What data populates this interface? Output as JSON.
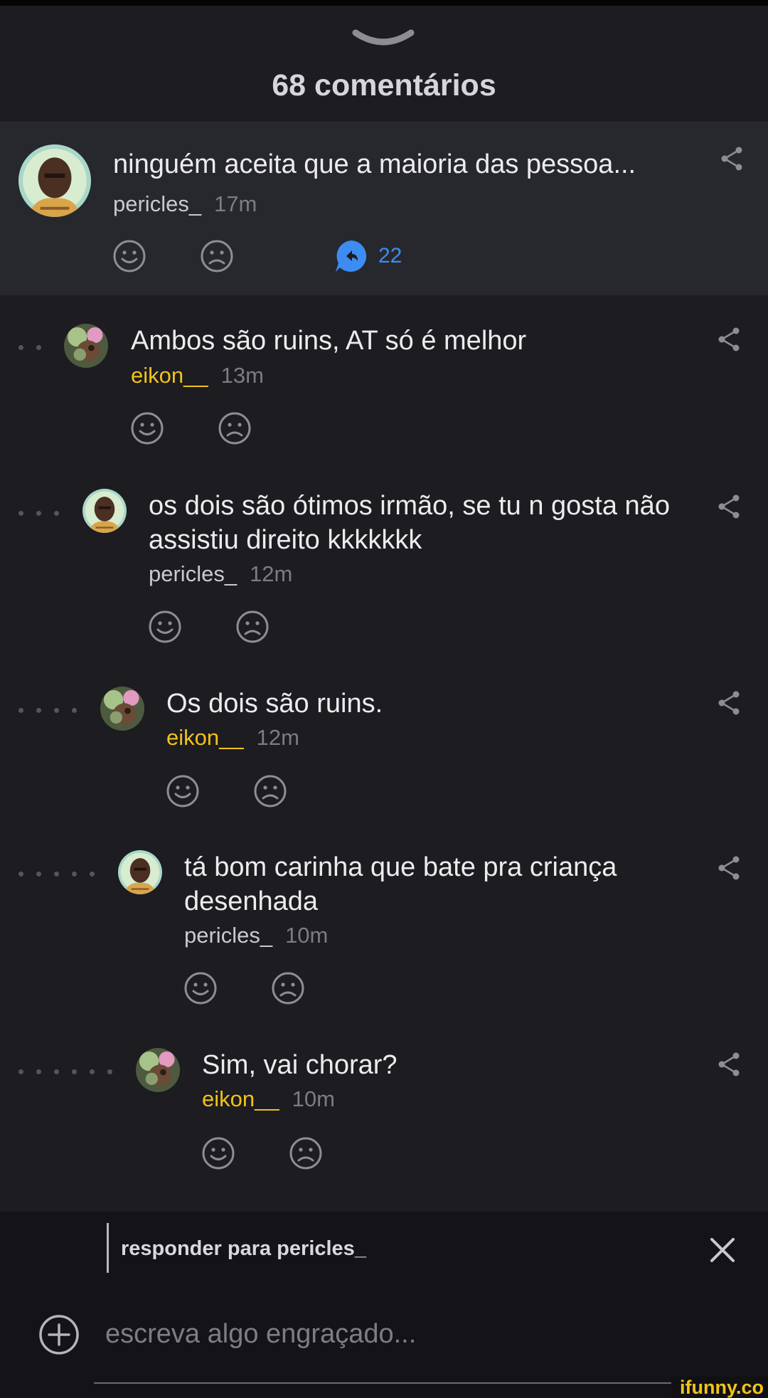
{
  "header": {
    "title": "68 comentários"
  },
  "comments": [
    {
      "text": "ninguém aceita que a maioria das pessoa...",
      "user": "pericles_",
      "time": "17m",
      "replies": "22",
      "depth": 0
    },
    {
      "text": "Ambos são ruins, AT só é melhor",
      "user": "eikon__",
      "time": "13m",
      "depth": 2
    },
    {
      "text": "os dois são ótimos irmão, se tu n gosta não assistiu direito kkkkkkk",
      "user": "pericles_",
      "time": "12m",
      "depth": 3
    },
    {
      "text": "Os dois são ruins.",
      "user": "eikon__",
      "time": "12m",
      "depth": 4
    },
    {
      "text": "tá bom carinha que bate pra criança desenhada",
      "user": "pericles_",
      "time": "10m",
      "depth": 5
    },
    {
      "text": "Sim, vai chorar?",
      "user": "eikon__",
      "time": "10m",
      "depth": 6
    }
  ],
  "reply": {
    "label": "responder para pericles_",
    "placeholder": "escreva algo engraçado..."
  },
  "watermark": "ifunny.co",
  "colors": {
    "background": "#1c1c21",
    "highlight": "#27282e",
    "username_alt": "#f1c21b",
    "link": "#3d8cf2"
  }
}
